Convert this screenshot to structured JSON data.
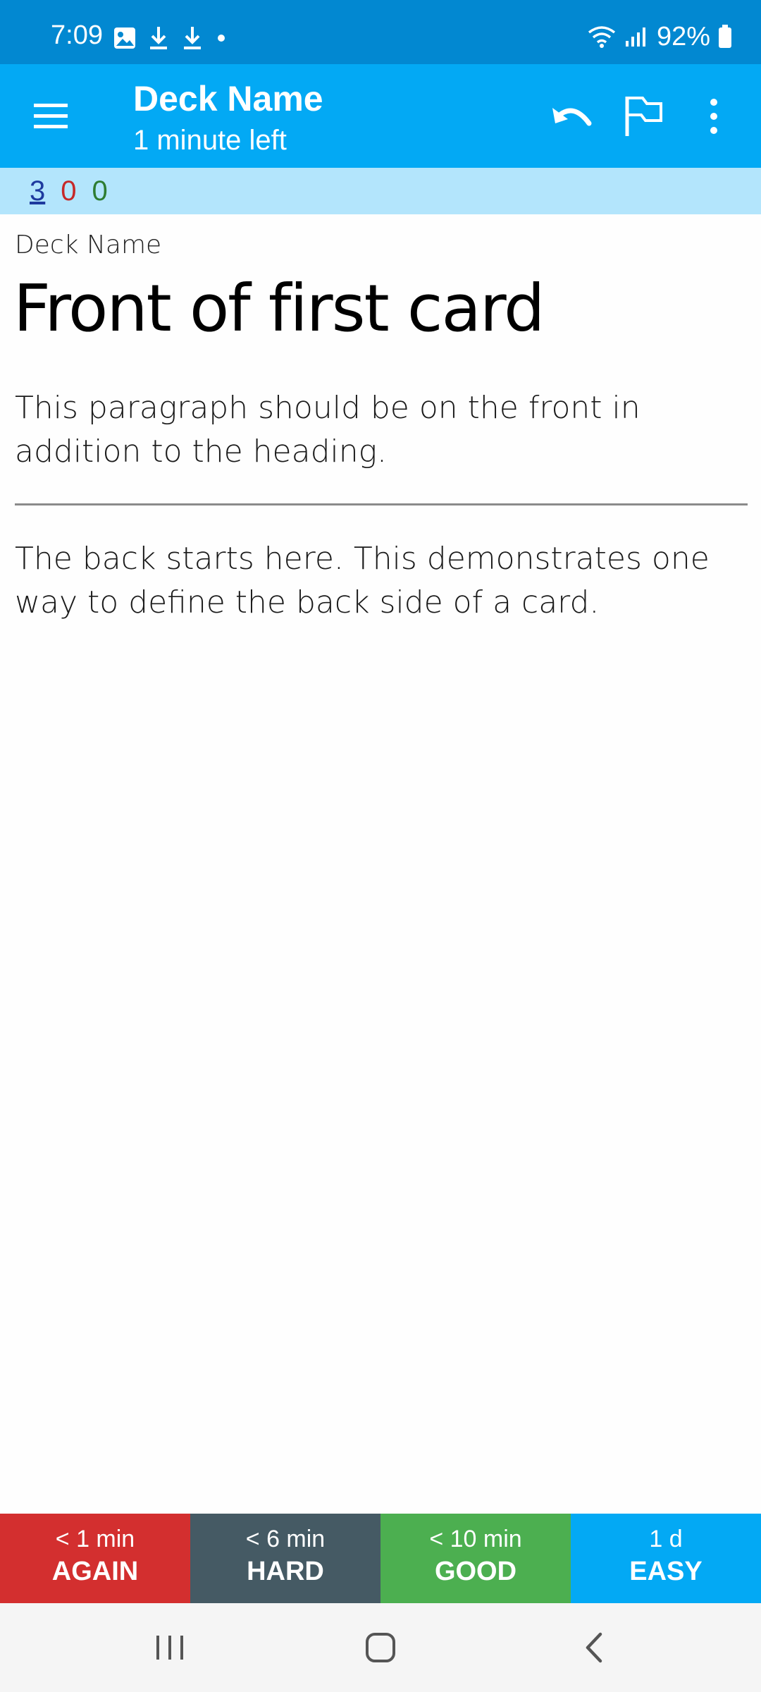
{
  "status_bar": {
    "time": "7:09",
    "battery": "92%",
    "icons": [
      "image-icon",
      "download-icon",
      "download-icon",
      "dot-icon",
      "wifi-icon",
      "signal-icon",
      "battery-icon"
    ]
  },
  "toolbar": {
    "title": "Deck Name",
    "subtitle": "1 minute left",
    "icons": [
      "menu-icon",
      "undo-icon",
      "flag-icon",
      "overflow-icon"
    ]
  },
  "counts": {
    "new": "3",
    "learning": "0",
    "review": "0",
    "colors": {
      "new": "#1e3a9e",
      "learning": "#c62828",
      "review": "#2e7d32"
    }
  },
  "card": {
    "deck": "Deck Name",
    "heading": "Front of first card",
    "front_text": "This paragraph should be on the front in addition to the heading.",
    "back_text": "The back starts here. This demonstrates one way to define the back side of a card."
  },
  "answers": [
    {
      "time": "< 1 min",
      "label": "AGAIN",
      "color": "#d32f2f"
    },
    {
      "time": "< 6 min",
      "label": "HARD",
      "color": "#455a64"
    },
    {
      "time": "< 10 min",
      "label": "GOOD",
      "color": "#4caf50"
    },
    {
      "time": "1 d",
      "label": "EASY",
      "color": "#03a9f4"
    }
  ],
  "nav_bar": {
    "icons": [
      "recents-icon",
      "home-icon",
      "back-icon"
    ]
  }
}
